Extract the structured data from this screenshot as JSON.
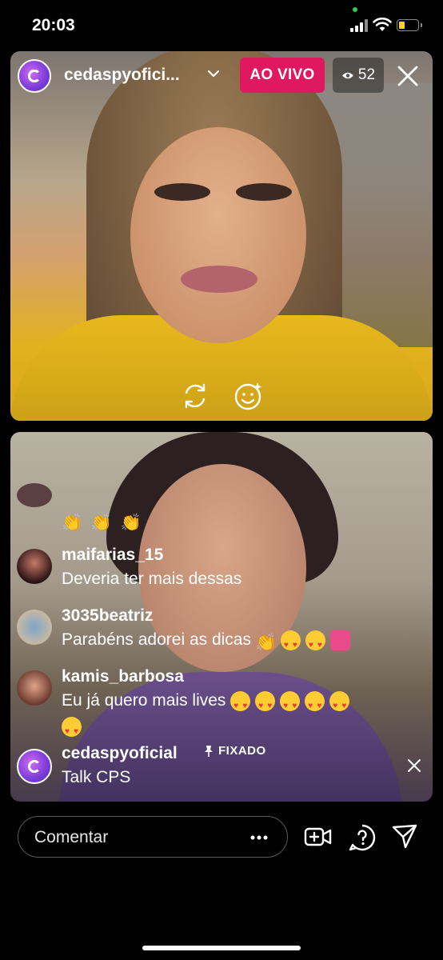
{
  "status_bar": {
    "time": "20:03"
  },
  "live": {
    "host_name": "cedaspyofici...",
    "live_badge": "AO VIVO",
    "viewer_count": "52"
  },
  "comments": [
    {
      "user": "maifarias_15",
      "text": "Deveria ter mais dessas"
    },
    {
      "user": "3035beatriz",
      "text": "Parabéns adorei as dicas"
    },
    {
      "user": "kamis_barbosa",
      "text": "Eu já quero mais lives"
    }
  ],
  "pinned": {
    "user": "cedaspyoficial",
    "tag": "FIXADO",
    "text": "Talk CPS"
  },
  "composer": {
    "placeholder": "Comentar"
  },
  "colors": {
    "live_badge": "#e0185f",
    "background": "#000000"
  }
}
